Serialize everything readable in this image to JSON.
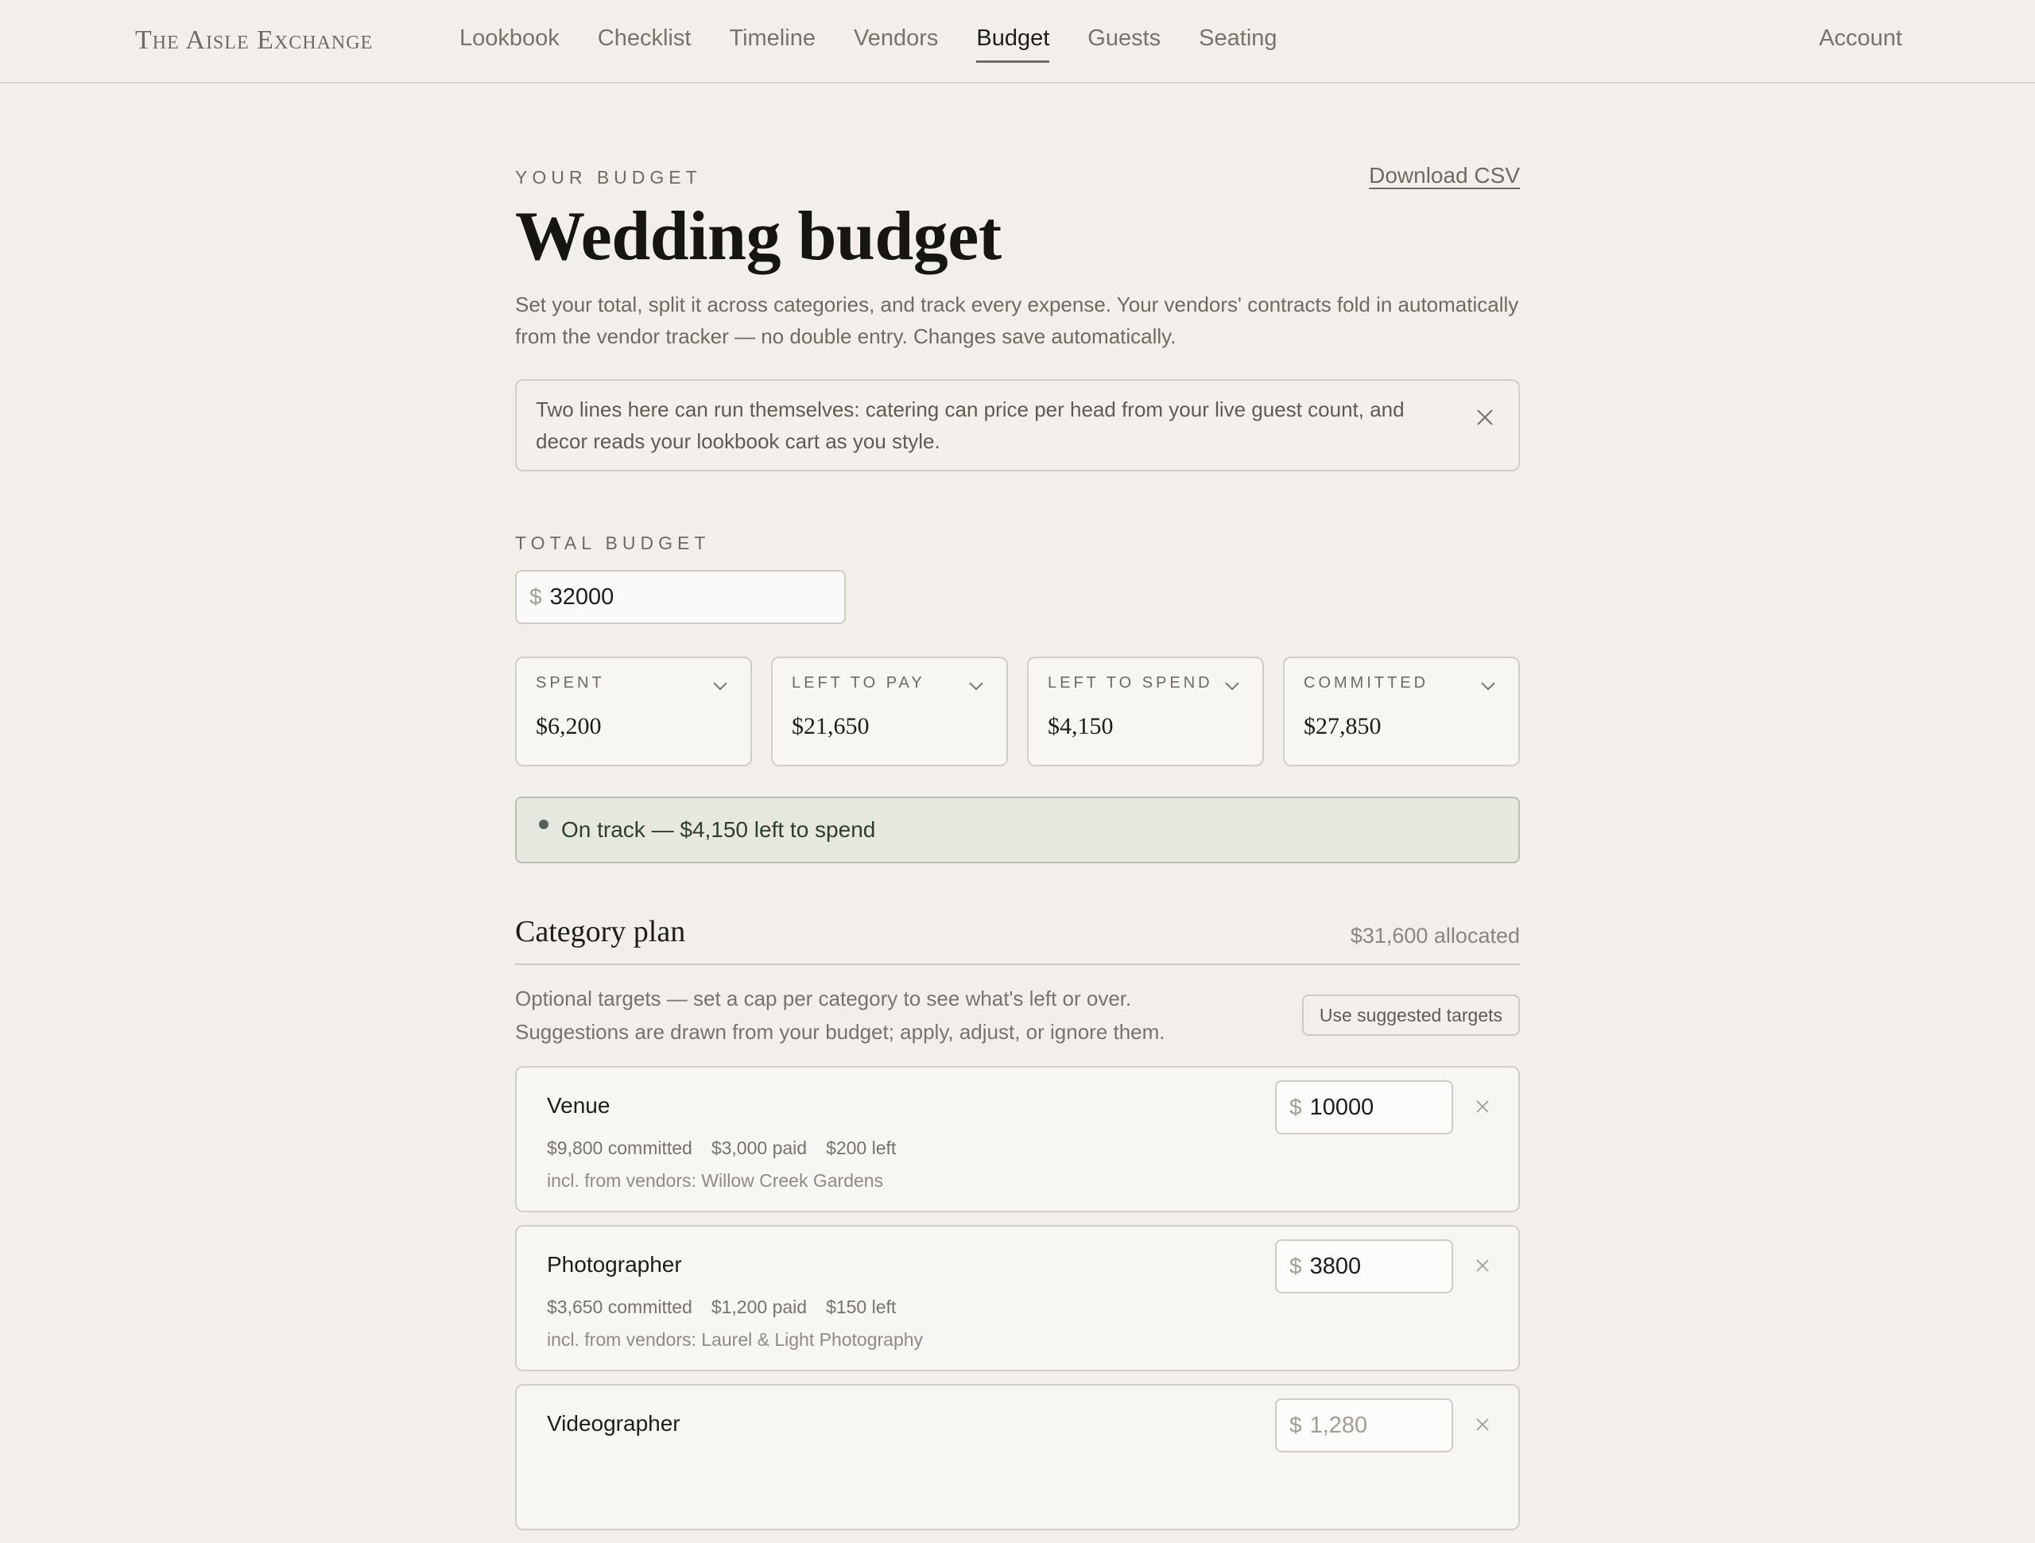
{
  "nav": {
    "brand": "The Aisle Exchange",
    "links": [
      "Lookbook",
      "Checklist",
      "Timeline",
      "Vendors",
      "Budget",
      "Guests",
      "Seating"
    ],
    "active": "Budget",
    "account": "Account"
  },
  "header": {
    "eyebrow": "Your budget",
    "download": "Download CSV",
    "title": "Wedding budget",
    "lede": "Set your total, split it across categories, and track every expense. Your vendors' contracts fold in automatically from the vendor tracker — no double entry. Changes save automatically."
  },
  "notice": {
    "text": "Two lines here can run themselves: catering can price per head from your live guest count, and decor reads your lookbook cart as you style."
  },
  "total": {
    "label": "Total budget",
    "currency": "$",
    "value": "32000"
  },
  "stats": [
    {
      "label": "Spent",
      "value": "$6,200"
    },
    {
      "label": "Left to pay",
      "value": "$21,650"
    },
    {
      "label": "Left to spend",
      "value": "$4,150"
    },
    {
      "label": "Committed",
      "value": "$27,850"
    }
  ],
  "status": {
    "text": "On track — $4,150 left to spend",
    "color": "#58605a"
  },
  "categories": {
    "title": "Category plan",
    "allocated": "$31,600 allocated",
    "desc_line1": "Optional targets — set a cap per category to see what's left or over.",
    "desc_line2": "Suggestions are drawn from your budget; apply, adjust, or ignore them.",
    "suggest_button": "Use suggested targets",
    "items": [
      {
        "name": "Venue",
        "target": "10000",
        "committed": "$9,800 committed",
        "paid": "$3,000 paid",
        "left": "$200 left",
        "vendors": "incl. from vendors: Willow Creek Gardens"
      },
      {
        "name": "Photographer",
        "target": "3800",
        "committed": "$3,650 committed",
        "paid": "$1,200 paid",
        "left": "$150 left",
        "vendors": "incl. from vendors: Laurel & Light Photography"
      },
      {
        "name": "Videographer",
        "placeholder": "1,280"
      }
    ]
  }
}
